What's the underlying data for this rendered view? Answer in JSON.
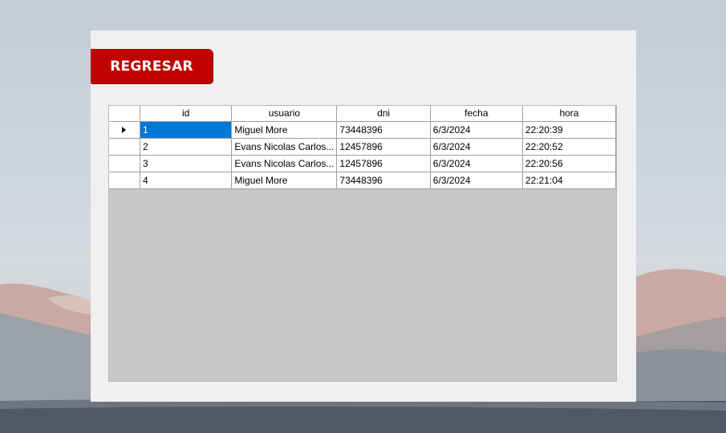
{
  "back_button": {
    "label": "REGRESAR"
  },
  "grid": {
    "columns": [
      "id",
      "usuario",
      "dni",
      "fecha",
      "hora"
    ],
    "rows": [
      {
        "id": "1",
        "usuario": "Miguel More",
        "dni": "73448396",
        "fecha": "6/3/2024",
        "hora": "22:20:39"
      },
      {
        "id": "2",
        "usuario": "Evans Nicolas Carlos...",
        "dni": "12457896",
        "fecha": "6/3/2024",
        "hora": "22:20:52"
      },
      {
        "id": "3",
        "usuario": "Evans Nicolas Carlos...",
        "dni": "12457896",
        "fecha": "6/3/2024",
        "hora": "22:20:56"
      },
      {
        "id": "4",
        "usuario": "Miguel More",
        "dni": "73448396",
        "fecha": "6/3/2024",
        "hora": "22:21:04"
      }
    ],
    "selected_row": 0,
    "selected_column": "id"
  },
  "colors": {
    "button_bg": "#c00000",
    "selection": "#0078d7",
    "grid_background": "#c8c8c8",
    "form_background": "#f0f0f0"
  },
  "icons": {
    "current_row": "row-pointer-icon"
  }
}
